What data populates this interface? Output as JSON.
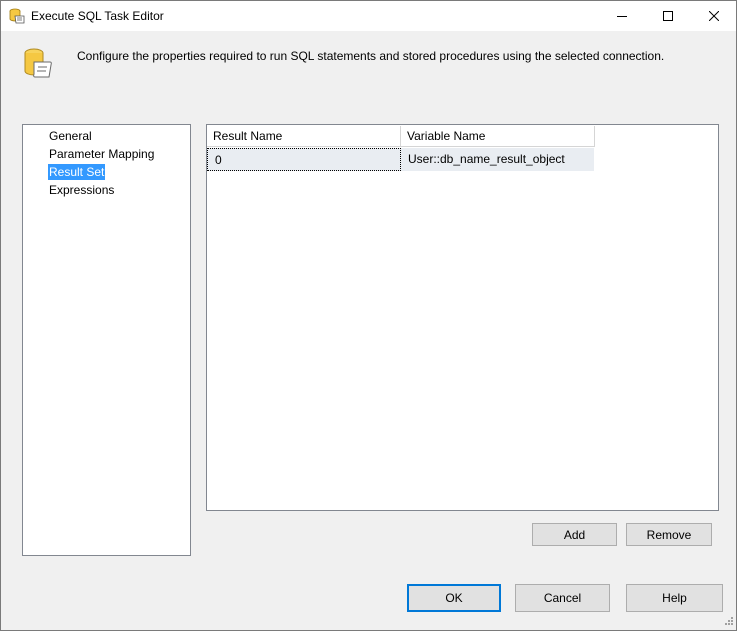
{
  "window": {
    "title": "Execute SQL Task Editor",
    "title_icon": "sql-task-icon",
    "controls": {
      "minimize": "minimize-icon",
      "maximize": "maximize-icon",
      "close": "close-icon"
    }
  },
  "header": {
    "icon": "sql-task-icon",
    "description": "Configure the properties required to run SQL statements and stored procedures using the selected connection."
  },
  "nav": {
    "items": [
      {
        "label": "General",
        "selected": false
      },
      {
        "label": "Parameter Mapping",
        "selected": false
      },
      {
        "label": "Result Set",
        "selected": true
      },
      {
        "label": "Expressions",
        "selected": false
      }
    ]
  },
  "result_set": {
    "columns": [
      "Result Name",
      "Variable Name"
    ],
    "rows": [
      [
        "0",
        "User::db_name_result_object"
      ]
    ],
    "add_label": "Add",
    "remove_label": "Remove"
  },
  "footer": {
    "ok_label": "OK",
    "cancel_label": "Cancel",
    "help_label": "Help"
  },
  "colors": {
    "selection": "#3399ff",
    "default_button_border": "#0078d7",
    "row_background": "#e9edf2"
  }
}
